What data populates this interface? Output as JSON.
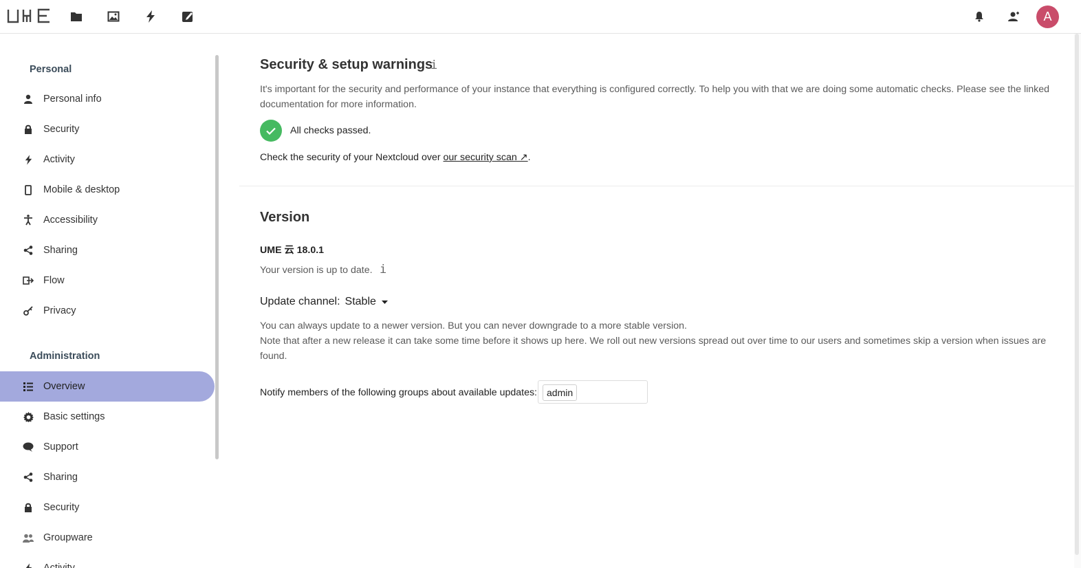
{
  "header": {
    "logo_text": "UME",
    "apps": [
      {
        "name": "files-icon"
      },
      {
        "name": "photos-icon"
      },
      {
        "name": "activity-icon"
      },
      {
        "name": "notes-icon"
      }
    ],
    "right_icons": [
      {
        "name": "bell-icon"
      },
      {
        "name": "contacts-icon"
      }
    ],
    "avatar_letter": "A",
    "avatar_color": "#c94c6a"
  },
  "sidebar": {
    "personal_caption": "Personal",
    "personal_items": [
      {
        "label": "Personal info",
        "icon": "person-icon"
      },
      {
        "label": "Security",
        "icon": "lock-icon"
      },
      {
        "label": "Activity",
        "icon": "activity-icon"
      },
      {
        "label": "Mobile & desktop",
        "icon": "phone-icon"
      },
      {
        "label": "Accessibility",
        "icon": "accessibility-icon"
      },
      {
        "label": "Sharing",
        "icon": "share-icon"
      },
      {
        "label": "Flow",
        "icon": "flow-icon"
      },
      {
        "label": "Privacy",
        "icon": "key-icon"
      }
    ],
    "admin_caption": "Administration",
    "admin_items": [
      {
        "label": "Overview",
        "icon": "list-icon",
        "active": true
      },
      {
        "label": "Basic settings",
        "icon": "gear-icon"
      },
      {
        "label": "Support",
        "icon": "chat-icon"
      },
      {
        "label": "Sharing",
        "icon": "share-icon"
      },
      {
        "label": "Security",
        "icon": "lock-icon"
      },
      {
        "label": "Groupware",
        "icon": "group-icon"
      },
      {
        "label": "Activity",
        "icon": "activity-icon"
      }
    ],
    "active_color": "#a3a9dd"
  },
  "security": {
    "title": "Security & setup warnings",
    "info_glyph": "i",
    "description": "It's important for the security and performance of your instance that everything is configured correctly. To help you with that we are doing some automatic checks. Please see the linked documentation for more information.",
    "checks_status": "All checks passed.",
    "scan_prefix": "Check the security of your Nextcloud over ",
    "scan_link": "our security scan ↗",
    "scan_suffix": ".",
    "success_color": "#46ba61"
  },
  "version": {
    "title": "Version",
    "product": "UME 云 18.0.1",
    "status": "Your version is up to date.",
    "info_glyph": "i",
    "channel_label": "Update channel:",
    "channel_value": "Stable",
    "note_line1": "You can always update to a newer version. But you can never downgrade to a more stable version.",
    "note_line2": "Note that after a new release it can take some time before it shows up here. We roll out new versions spread out over time to our users and sometimes skip a version when issues are found.",
    "notify_label": "Notify members of the following groups about available updates:",
    "notify_group": "admin"
  }
}
